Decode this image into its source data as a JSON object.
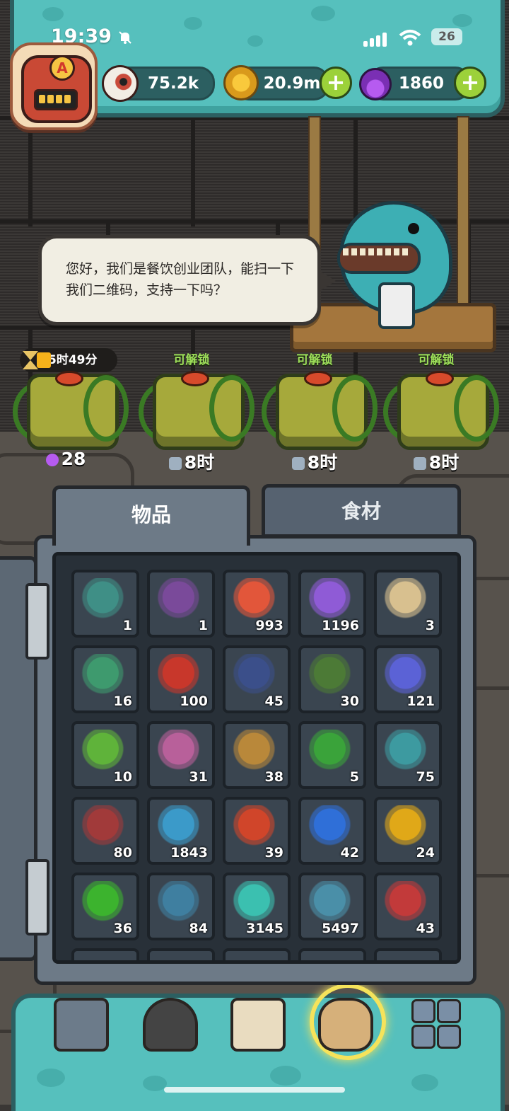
{
  "status_bar": {
    "time": "19:39",
    "battery": "26",
    "icons": [
      "bell-muted-icon",
      "signal-icon",
      "wifi-icon",
      "battery-icon"
    ]
  },
  "player": {
    "avatar_letter": "A"
  },
  "resources": [
    {
      "name": "eyeball",
      "value": "75.2k",
      "icon": "eyeball-icon"
    },
    {
      "name": "coin",
      "value": "20.9m",
      "icon": "coin-icon",
      "has_plus": true
    },
    {
      "name": "potion",
      "value": "1860",
      "icon": "potion-icon",
      "has_plus": true
    }
  ],
  "npc": {
    "speech": "您好，我们是餐饮创业团队，能扫一下我们二维码，支持一下吗？"
  },
  "chests": [
    {
      "label": "",
      "timer": "5时49分",
      "count": "28",
      "count_icon": "potion-icon"
    },
    {
      "label": "可解锁",
      "count": "8时",
      "count_icon": "lock-icon"
    },
    {
      "label": "可解锁",
      "count": "8时",
      "count_icon": "lock-icon"
    },
    {
      "label": "可解锁",
      "count": "8时",
      "count_icon": "lock-icon"
    }
  ],
  "tabs": [
    {
      "label": "物品",
      "active": true
    },
    {
      "label": "食材",
      "active": false
    }
  ],
  "inventory": [
    {
      "item": "bottle",
      "qty": "1",
      "color": "#3f8f86"
    },
    {
      "item": "monster-chest",
      "qty": "1",
      "color": "#7a4a9a"
    },
    {
      "item": "meat-bone",
      "qty": "993",
      "color": "#e2563a"
    },
    {
      "item": "purple-powder",
      "qty": "1196",
      "color": "#8f5bd6"
    },
    {
      "item": "map-scroll",
      "qty": "3",
      "color": "#d8c08f"
    },
    {
      "item": "ticket",
      "qty": "16",
      "color": "#3e9a6e"
    },
    {
      "item": "oil-barrel",
      "qty": "100",
      "color": "#c8372b"
    },
    {
      "item": "card-pack",
      "qty": "45",
      "color": "#3b4f8a"
    },
    {
      "item": "cauldron-card",
      "qty": "30",
      "color": "#4c7a36"
    },
    {
      "item": "crystal-cluster",
      "qty": "121",
      "color": "#5b62d6"
    },
    {
      "item": "slime-rock",
      "qty": "10",
      "color": "#5fb33a"
    },
    {
      "item": "recipe-scroll",
      "qty": "31",
      "color": "#b8609a"
    },
    {
      "item": "stained-card",
      "qty": "38",
      "color": "#b9883a"
    },
    {
      "item": "clover",
      "qty": "5",
      "color": "#3aa33a"
    },
    {
      "item": "soot-badge",
      "qty": "75",
      "color": "#3d9aa0"
    },
    {
      "item": "sock",
      "qty": "80",
      "color": "#a13a3a"
    },
    {
      "item": "blue-creature",
      "qty": "1843",
      "color": "#3b9ac9"
    },
    {
      "item": "red-gem",
      "qty": "39",
      "color": "#d0452a"
    },
    {
      "item": "blue-gem",
      "qty": "42",
      "color": "#2f6fd8"
    },
    {
      "item": "yellow-gem",
      "qty": "24",
      "color": "#e0a818"
    },
    {
      "item": "green-gem",
      "qty": "36",
      "color": "#3cb32e"
    },
    {
      "item": "soot-machine",
      "qty": "84",
      "color": "#3f7fa0"
    },
    {
      "item": "ghost-cloud",
      "qty": "3145",
      "color": "#3bc0b0"
    },
    {
      "item": "soot-lasso",
      "qty": "5497",
      "color": "#4a8fa8"
    },
    {
      "item": "soot-can",
      "qty": "43",
      "color": "#c23a3a"
    }
  ],
  "bottom_nav": [
    {
      "name": "shop",
      "icon": "shop-icon",
      "color": "#6c7b8a"
    },
    {
      "name": "monster",
      "icon": "fire-monster-icon",
      "color": "#444"
    },
    {
      "name": "book",
      "icon": "book-icon",
      "color": "#e9dcc0"
    },
    {
      "name": "bag",
      "icon": "money-bag-icon",
      "color": "#d6b07a",
      "active": true
    },
    {
      "name": "menu",
      "icon": "grid-menu-icon",
      "color": "#7a8fa6"
    }
  ]
}
